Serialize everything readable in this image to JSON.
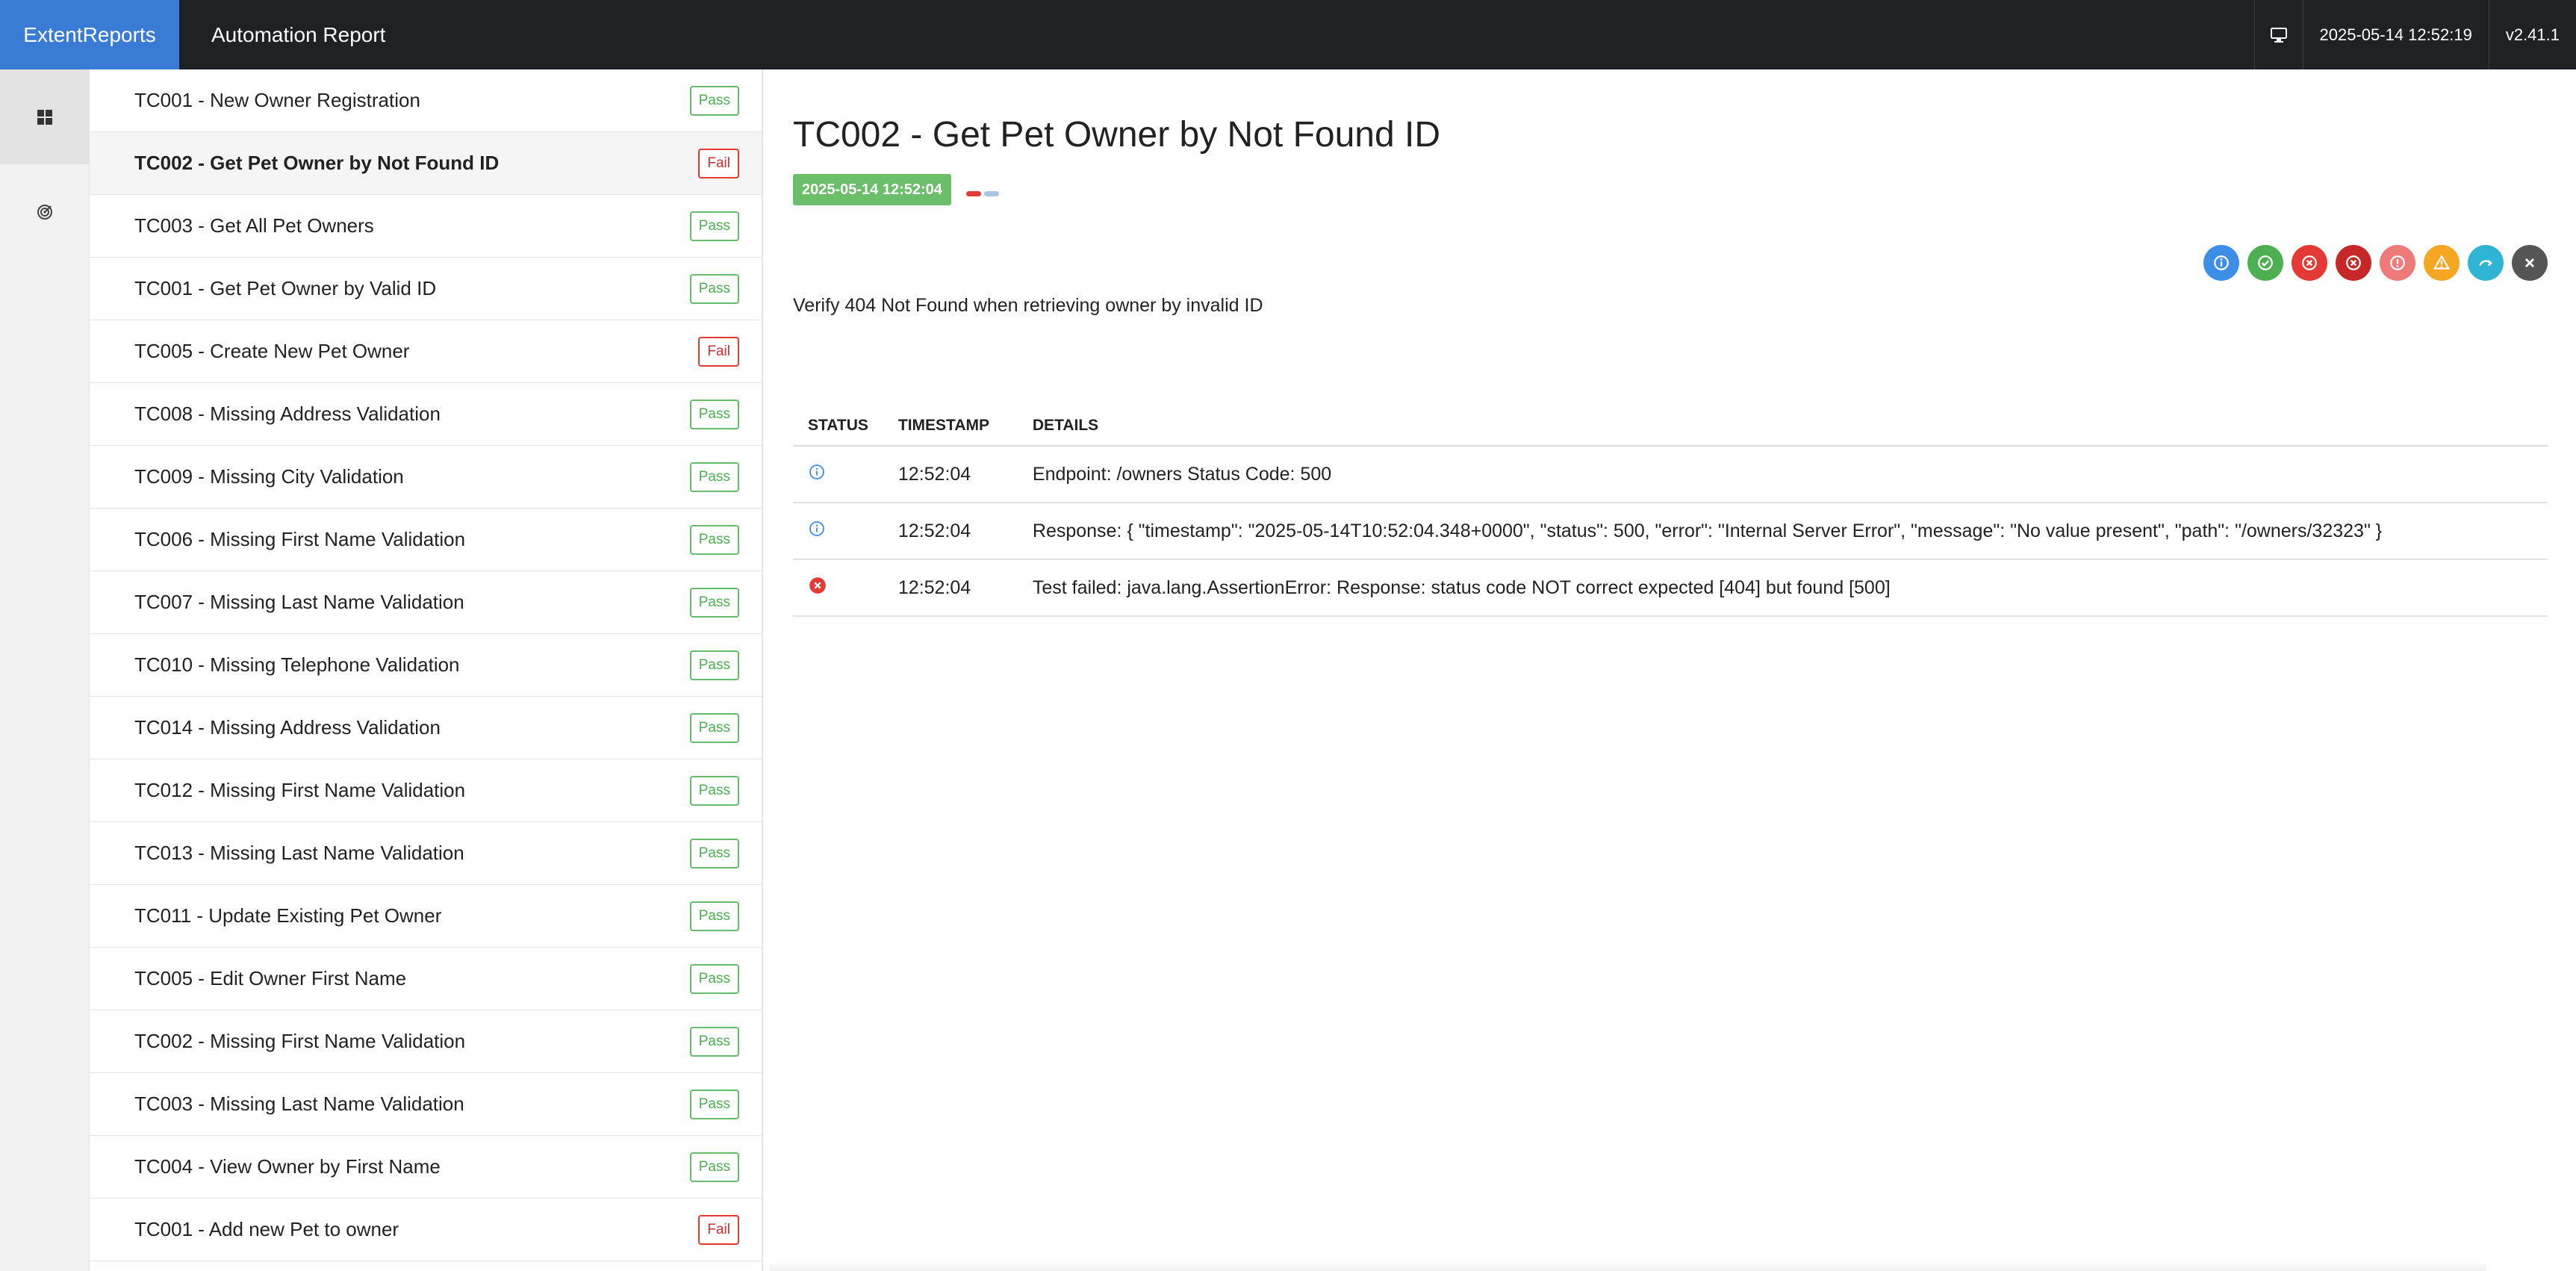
{
  "header": {
    "brand": "ExtentReports",
    "report_name": "Automation Report",
    "timestamp": "2025-05-14 12:52:19",
    "version": "v2.41.1"
  },
  "tests": [
    {
      "name": "TC001 - New Owner Registration",
      "status": "Pass"
    },
    {
      "name": "TC002 - Get Pet Owner by Not Found ID",
      "status": "Fail"
    },
    {
      "name": "TC003 - Get All Pet Owners",
      "status": "Pass"
    },
    {
      "name": "TC001 - Get Pet Owner by Valid ID",
      "status": "Pass"
    },
    {
      "name": "TC005 - Create New Pet Owner",
      "status": "Fail"
    },
    {
      "name": "TC008 - Missing Address Validation",
      "status": "Pass"
    },
    {
      "name": "TC009 - Missing City Validation",
      "status": "Pass"
    },
    {
      "name": "TC006 - Missing First Name Validation",
      "status": "Pass"
    },
    {
      "name": "TC007 - Missing Last Name Validation",
      "status": "Pass"
    },
    {
      "name": "TC010 - Missing Telephone Validation",
      "status": "Pass"
    },
    {
      "name": "TC014 - Missing Address Validation",
      "status": "Pass"
    },
    {
      "name": "TC012 - Missing First Name Validation",
      "status": "Pass"
    },
    {
      "name": "TC013 - Missing Last Name Validation",
      "status": "Pass"
    },
    {
      "name": "TC011 - Update Existing Pet Owner",
      "status": "Pass"
    },
    {
      "name": "TC005 - Edit Owner First Name",
      "status": "Pass"
    },
    {
      "name": "TC002 - Missing First Name Validation",
      "status": "Pass"
    },
    {
      "name": "TC003 - Missing Last Name Validation",
      "status": "Pass"
    },
    {
      "name": "TC004 - View Owner by First Name",
      "status": "Pass"
    },
    {
      "name": "TC001 - Add new Pet to owner",
      "status": "Fail"
    }
  ],
  "detail": {
    "title": "TC002 - Get Pet Owner by Not Found ID",
    "start_time": "2025-05-14 12:52:04",
    "description": "Verify 404 Not Found when retrieving owner by invalid ID",
    "columns": [
      "STATUS",
      "TIMESTAMP",
      "DETAILS"
    ],
    "logs": [
      {
        "status": "info",
        "time": "12:52:04",
        "details": "Endpoint: /owners Status Code: 500"
      },
      {
        "status": "info",
        "time": "12:52:04",
        "details": "Response: { \"timestamp\": \"2025-05-14T10:52:04.348+0000\", \"status\": 500, \"error\": \"Internal Server Error\", \"message\": \"No value present\", \"path\": \"/owners/32323\" }"
      },
      {
        "status": "fail",
        "time": "12:52:04",
        "details": "Test failed: java.lang.AssertionError: Response: status code NOT correct expected [404] but found [500]"
      }
    ]
  },
  "status_filters": [
    {
      "name": "info-filter",
      "color": "#3d8ee6",
      "icon": "info-icon"
    },
    {
      "name": "pass-filter",
      "color": "#4caf50",
      "icon": "check-icon"
    },
    {
      "name": "fail-filter",
      "color": "#e53935",
      "icon": "x-circle-icon"
    },
    {
      "name": "fatal-filter",
      "color": "#c62828",
      "icon": "x-circle-icon"
    },
    {
      "name": "error-filter",
      "color": "#ef7a7a",
      "icon": "exclamation-icon"
    },
    {
      "name": "warning-filter",
      "color": "#f5a623",
      "icon": "warning-icon"
    },
    {
      "name": "skip-filter",
      "color": "#2fb5d3",
      "icon": "skip-arrow-icon"
    },
    {
      "name": "clear-filter",
      "color": "#555555",
      "icon": "close-icon"
    }
  ],
  "colors": {
    "brand": "#3a7bd5",
    "topbar": "#1f2224",
    "pass": "#4caf50",
    "fail": "#d32f2f",
    "info": "#3d8ee6"
  }
}
